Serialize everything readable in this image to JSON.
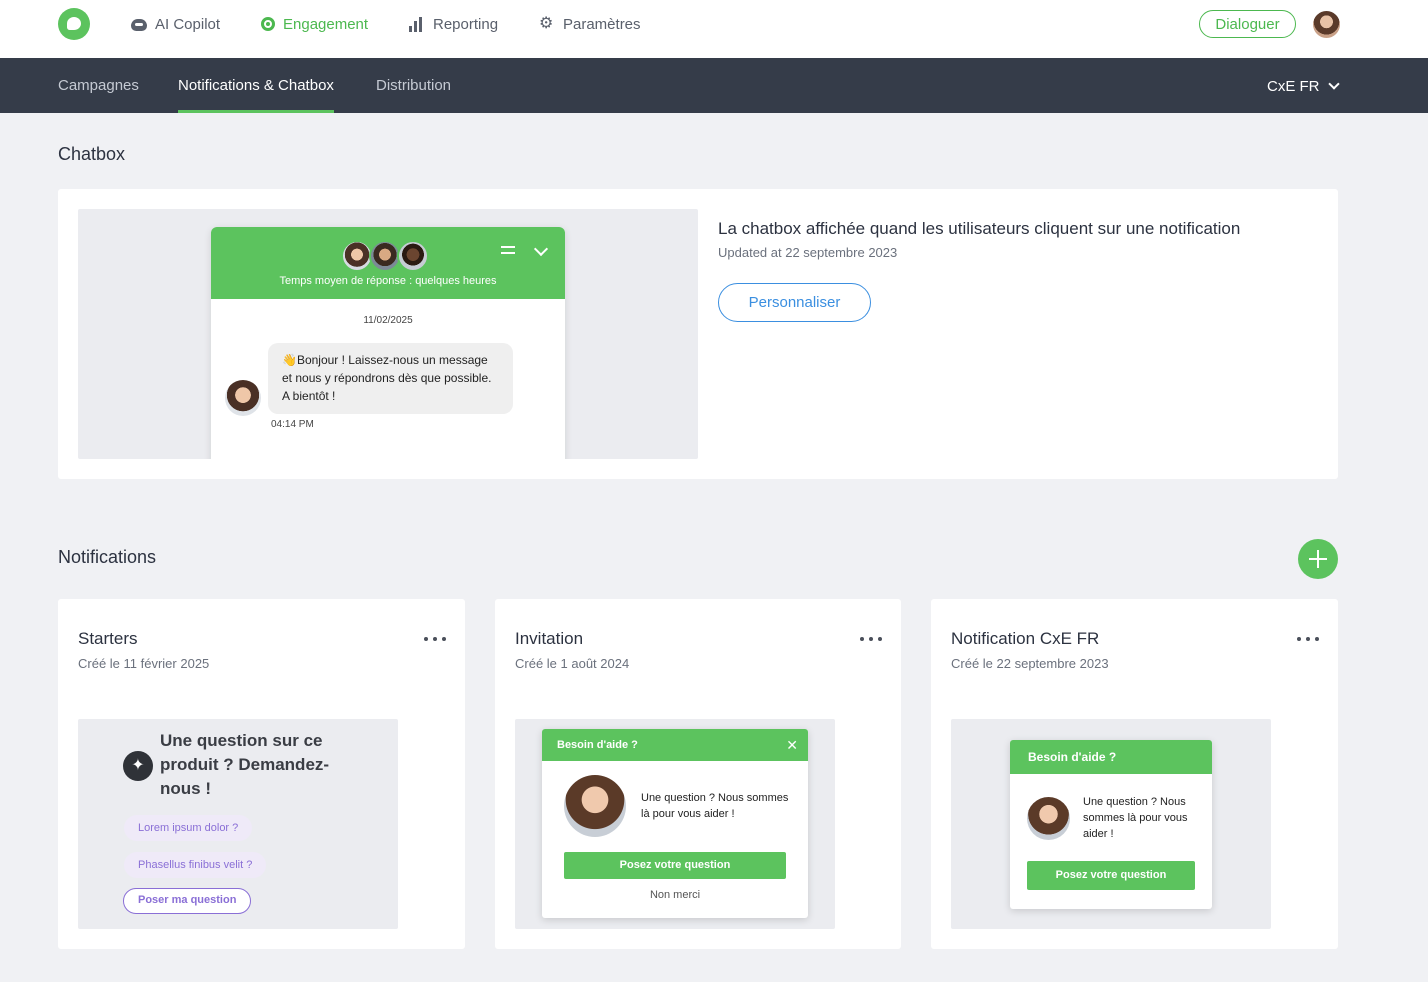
{
  "topnav": {
    "items": [
      {
        "label": "AI Copilot",
        "icon": "copilot-icon"
      },
      {
        "label": "Engagement",
        "icon": "engagement-icon",
        "active": true
      },
      {
        "label": "Reporting",
        "icon": "reporting-icon"
      },
      {
        "label": "Paramètres",
        "icon": "gear-icon"
      }
    ],
    "dialoguer_label": "Dialoguer",
    "accent": "#5cc35e"
  },
  "subnav": {
    "tabs": [
      {
        "label": "Campagnes"
      },
      {
        "label": "Notifications & Chatbox",
        "active": true
      },
      {
        "label": "Distribution"
      }
    ],
    "account": "CxE FR"
  },
  "chatbox": {
    "section_title": "Chatbox",
    "preview": {
      "subtitle": "Temps moyen de réponse : quelques heures",
      "date": "11/02/2025",
      "message": "👋Bonjour ! Laissez-nous un message et nous y répondrons dès que possible. A bientôt !",
      "time": "04:14 PM"
    },
    "title": "La chatbox affichée quand les utilisateurs cliquent sur une notification",
    "updated": "Updated at 22 septembre 2023",
    "customize_label": "Personnaliser"
  },
  "notifications": {
    "section_title": "Notifications",
    "cards": [
      {
        "title": "Starters",
        "created": "Créé le 11 février 2025",
        "preview": {
          "question": "Une question sur ce produit ? Demandez-nous !",
          "chips": [
            "Lorem ipsum dolor ?",
            "Phasellus finibus velit ?"
          ],
          "cta": "Poser ma question"
        }
      },
      {
        "title": "Invitation",
        "created": "Créé le 1 août 2024",
        "preview": {
          "header": "Besoin d'aide ?",
          "text": "Une question ? Nous sommes là pour vous aider !",
          "cta": "Posez votre question",
          "dismiss": "Non merci"
        }
      },
      {
        "title": "Notification CxE FR",
        "created": "Créé le 22 septembre 2023",
        "preview": {
          "header": "Besoin d'aide ?",
          "text": "Une question ? Nous sommes là pour vous aider !",
          "cta": "Posez votre question"
        }
      }
    ]
  }
}
